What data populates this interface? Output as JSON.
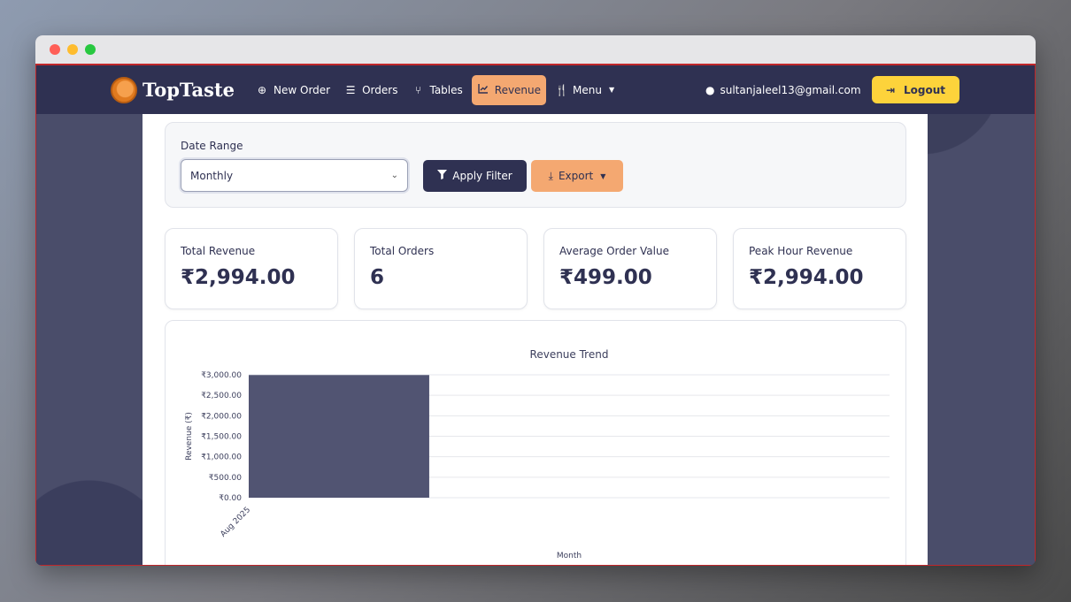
{
  "window": {
    "traffic_lights": [
      "close",
      "minimize",
      "maximize"
    ]
  },
  "nav": {
    "brand": "TopTaste",
    "items": [
      {
        "label": "New Order",
        "icon": "plus-circle-icon"
      },
      {
        "label": "Orders",
        "icon": "list-icon"
      },
      {
        "label": "Tables",
        "icon": "chair-icon"
      },
      {
        "label": "Revenue",
        "icon": "chart-line-icon",
        "active": true
      },
      {
        "label": "Menu",
        "icon": "utensils-icon",
        "dropdown": true
      }
    ],
    "user_email": "sultanjaleel13@gmail.com",
    "logout_label": "Logout"
  },
  "filter": {
    "label": "Date Range",
    "selected": "Monthly",
    "apply_label": "Apply Filter",
    "export_label": "Export"
  },
  "stats": [
    {
      "label": "Total Revenue",
      "value": "₹2,994.00"
    },
    {
      "label": "Total Orders",
      "value": "6"
    },
    {
      "label": "Average Order Value",
      "value": "₹499.00"
    },
    {
      "label": "Peak Hour Revenue",
      "value": "₹2,994.00"
    }
  ],
  "colors": {
    "navbar": "#2f3152",
    "accent": "#f4a871",
    "logout": "#fdd33b",
    "bar": "#515472"
  },
  "chart_data": {
    "type": "bar",
    "title": "Revenue Trend",
    "xlabel": "Month",
    "ylabel": "Revenue (₹)",
    "categories": [
      "Aug 2025"
    ],
    "values": [
      2994
    ],
    "ylim": [
      0,
      3000
    ],
    "yticks": [
      "₹0.00",
      "₹500.00",
      "₹1,000.00",
      "₹1,500.00",
      "₹2,000.00",
      "₹2,500.00",
      "₹3,000.00"
    ],
    "ytick_values": [
      0,
      500,
      1000,
      1500,
      2000,
      2500,
      3000
    ],
    "grid": true,
    "legend": "none"
  }
}
